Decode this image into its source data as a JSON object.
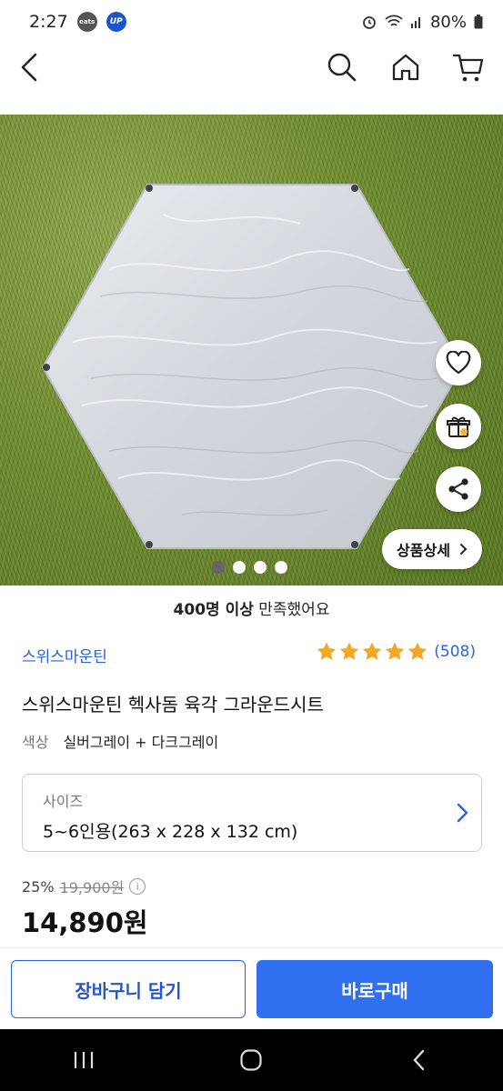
{
  "status_bar": {
    "time": "2:27",
    "badges": [
      "eats",
      "UP"
    ],
    "battery": "80%"
  },
  "nav_icons": [
    "back-icon",
    "search-icon",
    "home-icon",
    "cart-icon"
  ],
  "hero": {
    "side_actions": [
      "heart-icon",
      "gift-icon",
      "share-icon"
    ],
    "detail_button": "상품상세",
    "slides_total": 4,
    "active_slide": 1
  },
  "satisfaction": {
    "count": "400명 이상",
    "text": "만족했어요"
  },
  "seller": "스위스마운틴",
  "rating": {
    "stars": 5,
    "reviews": "(508)"
  },
  "product": {
    "title": "스위스마운틴 헥사돔 육각 그라운드시트",
    "color_label": "색상",
    "color_value": "실버그레이 + 다크그레이"
  },
  "size": {
    "label": "사이즈",
    "value": "5~6인용(263 x 228 x 132 cm)"
  },
  "price": {
    "discount": "25%",
    "original": "19,900원",
    "final": "14,890원"
  },
  "actions": {
    "cart": "장바구니 담기",
    "buy": "바로구매"
  },
  "colors": {
    "accent": "#2f6ff0",
    "link": "#2b63d9",
    "star": "#f6a623"
  }
}
